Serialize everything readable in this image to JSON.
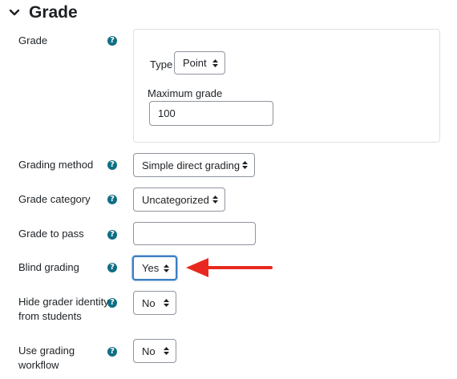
{
  "section": {
    "title": "Grade",
    "expanded_icon": "chevron-down-icon"
  },
  "help_glyph": "?",
  "grade": {
    "label": "Grade",
    "type_label": "Type",
    "type_value": "Point",
    "max_grade_label": "Maximum grade",
    "max_grade_value": "100"
  },
  "grading_method": {
    "label": "Grading method",
    "value": "Simple direct grading"
  },
  "grade_category": {
    "label": "Grade category",
    "value": "Uncategorized"
  },
  "grade_to_pass": {
    "label": "Grade to pass",
    "value": ""
  },
  "blind_grading": {
    "label": "Blind grading",
    "value": "Yes"
  },
  "hide_grader": {
    "label_line1": "Hide grader identity",
    "label_line2": "from students",
    "value": "No"
  },
  "grading_workflow": {
    "label_line1": "Use grading",
    "label_line2": "workflow",
    "value": "No"
  },
  "colors": {
    "help": "#0f6e84",
    "arrow": "#e8281e",
    "focus": "#3d7fc2"
  }
}
